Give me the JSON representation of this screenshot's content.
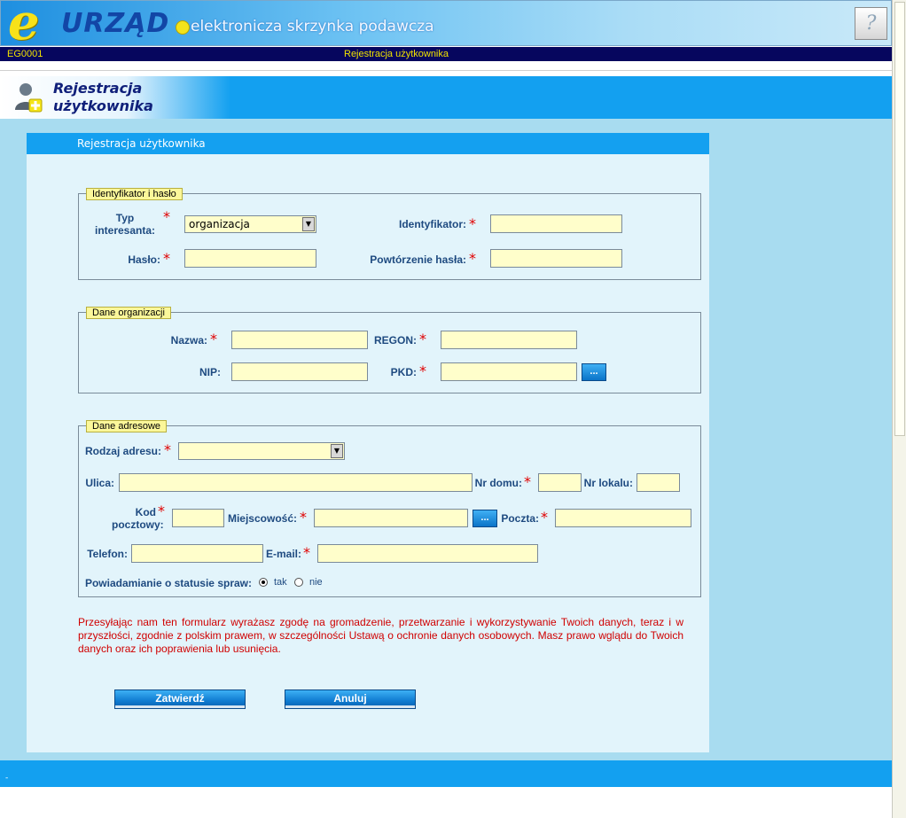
{
  "banner": {
    "logo_e": "e",
    "logo_main": "URZĄD",
    "subtitle": "elektronicza skrzynka podawcza",
    "help_label": "?"
  },
  "statusbar": {
    "code": "EG0001",
    "title": "Rejestracja użytkownika"
  },
  "page": {
    "title": "Rejestracja użytkownika"
  },
  "panel": {
    "title": "Rejestracja użytkownika"
  },
  "identyfikator_section": {
    "legend": "Identyfikator i hasło",
    "typ_label": "Typ interesanta:",
    "typ_value": "organizacja",
    "identyfikator_label": "Identyfikator:",
    "identyfikator_value": "",
    "haslo_label": "Hasło:",
    "haslo_value": "",
    "powtorzenie_label": "Powtórzenie hasła:",
    "powtorzenie_value": ""
  },
  "organizacja_section": {
    "legend": "Dane organizacji",
    "nazwa_label": "Nazwa:",
    "nazwa_value": "",
    "regon_label": "REGON:",
    "regon_value": "",
    "nip_label": "NIP:",
    "nip_value": "",
    "pkd_label": "PKD:",
    "pkd_value": "",
    "pkd_button": "..."
  },
  "adres_section": {
    "legend": "Dane adresowe",
    "rodzaj_label": "Rodzaj adresu:",
    "rodzaj_value": "",
    "ulica_label": "Ulica:",
    "ulica_value": "",
    "nr_domu_label": "Nr domu:",
    "nr_domu_value": "",
    "nr_lokalu_label": "Nr lokalu:",
    "nr_lokalu_value": "",
    "kod_label": "Kod pocztowy:",
    "kod_value": "",
    "miejscowosc_label": "Miejscowość:",
    "miejscowosc_value": "",
    "miejscowosc_button": "...",
    "poczta_label": "Poczta:",
    "poczta_value": "",
    "telefon_label": "Telefon:",
    "telefon_value": "",
    "email_label": "E-mail:",
    "email_value": "",
    "powiadamianie_label": "Powiadamianie o statusie spraw:",
    "option_tak": "tak",
    "option_nie": "nie",
    "selected": "tak"
  },
  "consent_text": "Przesyłając nam ten formularz wyrażasz zgodę na gromadzenie, przetwarzanie i wykorzystywanie Twoich danych, teraz i w przyszłości, zgodnie z polskim prawem, w szczególności Ustawą o ochronie danych osobowych. Masz prawo wglądu do Twoich danych oraz ich poprawienia lub usunięcia.",
  "buttons": {
    "submit": "Zatwierdź",
    "cancel": "Anuluj"
  },
  "footer": {
    "text": "-"
  },
  "colors": {
    "header_blue": "#13a0f0",
    "navy": "#06065e",
    "status_yellow": "#f0e100",
    "input_yellow": "#fffecb",
    "required_red": "#e00000"
  }
}
